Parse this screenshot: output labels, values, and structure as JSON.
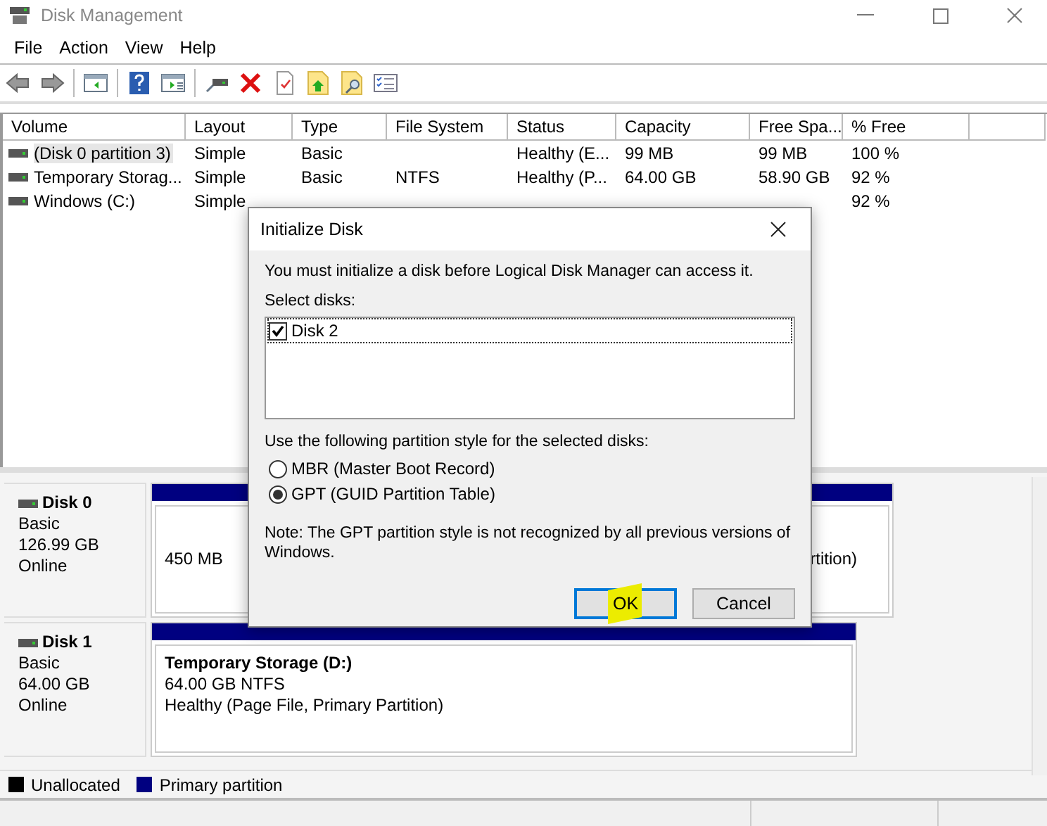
{
  "window": {
    "title": "Disk Management"
  },
  "menu": [
    "File",
    "Action",
    "View",
    "Help"
  ],
  "volumes": {
    "columns": [
      "Volume",
      "Layout",
      "Type",
      "File System",
      "Status",
      "Capacity",
      "Free Spa...",
      "% Free"
    ],
    "rows": [
      {
        "selected": true,
        "cells": [
          "(Disk 0 partition 3)",
          "Simple",
          "Basic",
          null,
          "Healthy (E...",
          "99 MB",
          "99 MB",
          "100 %"
        ]
      },
      {
        "selected": false,
        "cells": [
          "Temporary Storag...",
          "Simple",
          "Basic",
          "NTFS",
          "Healthy (P...",
          "64.00 GB",
          "58.90 GB",
          "92 %"
        ]
      },
      {
        "selected": false,
        "cells": [
          "Windows (C:)",
          "Simple",
          null,
          null,
          null,
          null,
          null,
          "92 %"
        ]
      }
    ]
  },
  "disks": [
    {
      "name": "Disk 0",
      "type": "Basic",
      "size": "126.99 GB",
      "status": "Online",
      "partitions": [
        {
          "lines": [
            "450 MB"
          ]
        },
        {
          "lines": [
            "rtition)"
          ]
        }
      ]
    },
    {
      "name": "Disk 1",
      "type": "Basic",
      "size": "64.00 GB",
      "status": "Online",
      "partitions": [
        {
          "title": "Temporary Storage  (D:)",
          "lines": [
            "64.00 GB NTFS",
            "Healthy (Page File, Primary Partition)"
          ]
        }
      ]
    }
  ],
  "legend": [
    {
      "label": "Unallocated",
      "color": "#000000"
    },
    {
      "label": "Primary partition",
      "color": "#000080"
    }
  ],
  "dialog": {
    "title": "Initialize Disk",
    "message": "You must initialize a disk before Logical Disk Manager can access it.",
    "select_label": "Select disks:",
    "disks": [
      {
        "label": "Disk 2",
        "checked": true,
        "selected": true
      }
    ],
    "style_prompt": "Use the following partition style for the selected disks:",
    "styles": [
      {
        "label": "MBR (Master Boot Record)",
        "selected": false
      },
      {
        "label": "GPT (GUID Partition Table)",
        "selected": true
      }
    ],
    "note": "Note: The GPT partition style is not recognized by all previous versions of Windows.",
    "buttons": [
      {
        "label": "OK",
        "default": true,
        "highlighted": true
      },
      {
        "label": "Cancel",
        "default": false,
        "highlighted": false
      }
    ]
  }
}
